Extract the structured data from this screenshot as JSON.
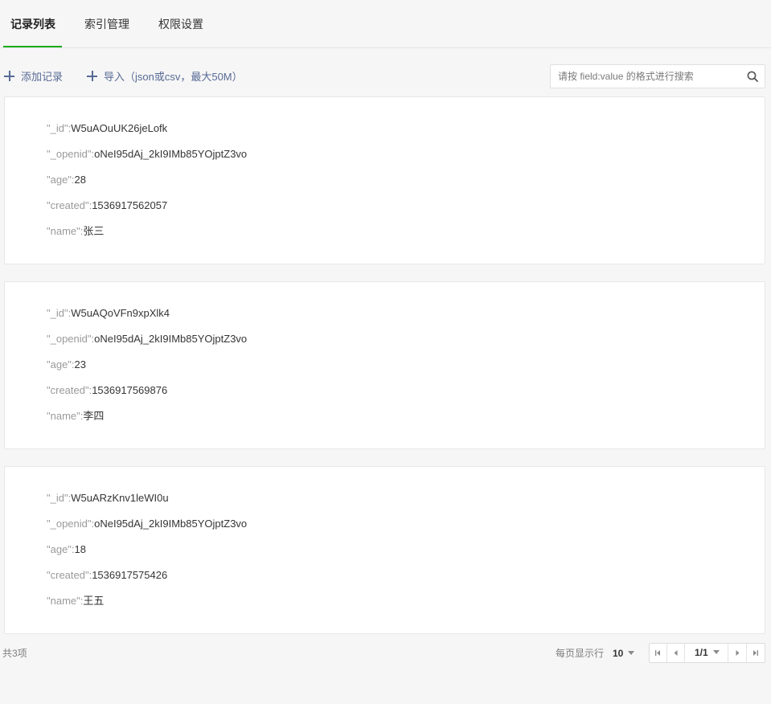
{
  "tabs": [
    {
      "label": "记录列表",
      "active": true
    },
    {
      "label": "索引管理",
      "active": false
    },
    {
      "label": "权限设置",
      "active": false
    }
  ],
  "toolbar": {
    "add_label": "添加记录",
    "import_label": "导入（json或csv，最大50M）",
    "add_icon": "plus-icon",
    "import_icon": "plus-icon"
  },
  "search": {
    "placeholder": "请按 field:value 的格式进行搜索",
    "icon": "search-icon"
  },
  "records": [
    {
      "fields": [
        {
          "key": "\"_id\":",
          "value": "W5uAOuUK26jeLofk"
        },
        {
          "key": "\"_openid\":",
          "value": "oNeI95dAj_2kI9IMb85YOjptZ3vo"
        },
        {
          "key": "\"age\":",
          "value": "28"
        },
        {
          "key": "\"created\":",
          "value": "1536917562057"
        },
        {
          "key": "\"name\":",
          "value": "张三"
        }
      ]
    },
    {
      "fields": [
        {
          "key": "\"_id\":",
          "value": "W5uAQoVFn9xpXlk4"
        },
        {
          "key": "\"_openid\":",
          "value": "oNeI95dAj_2kI9IMb85YOjptZ3vo"
        },
        {
          "key": "\"age\":",
          "value": "23"
        },
        {
          "key": "\"created\":",
          "value": "1536917569876"
        },
        {
          "key": "\"name\":",
          "value": "李四"
        }
      ]
    },
    {
      "fields": [
        {
          "key": "\"_id\":",
          "value": "W5uARzKnv1leWI0u"
        },
        {
          "key": "\"_openid\":",
          "value": "oNeI95dAj_2kI9IMb85YOjptZ3vo"
        },
        {
          "key": "\"age\":",
          "value": "18"
        },
        {
          "key": "\"created\":",
          "value": "1536917575426"
        },
        {
          "key": "\"name\":",
          "value": "王五"
        }
      ]
    }
  ],
  "footer": {
    "total": "共3项",
    "per_page_label": "每页显示行",
    "per_page_value": "10",
    "current_page": "1/1"
  },
  "colors": {
    "accent": "#1aad19",
    "link": "#576b95"
  }
}
